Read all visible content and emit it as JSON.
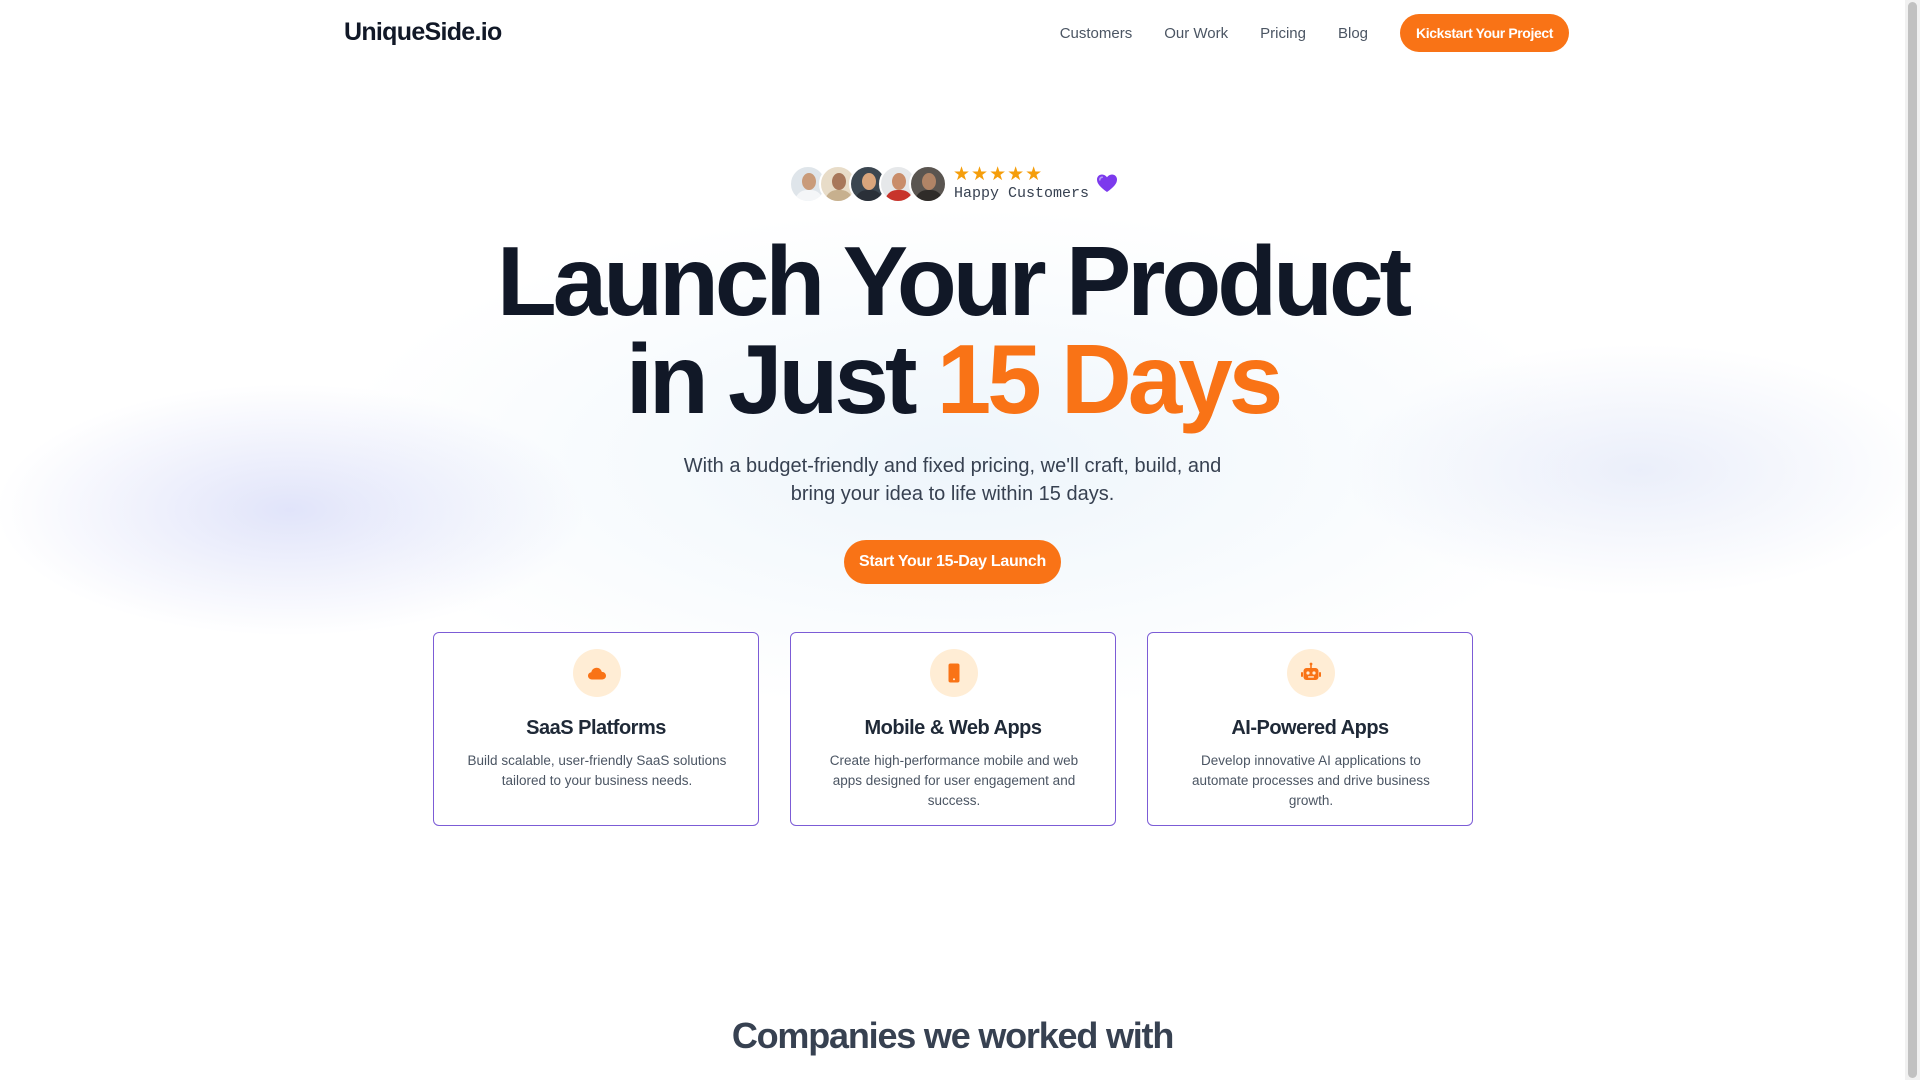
{
  "header": {
    "logo": "UniqueSide.io",
    "nav": [
      "Customers",
      "Our Work",
      "Pricing",
      "Blog"
    ],
    "cta_label": "Kickstart Your Project"
  },
  "social_proof": {
    "rating_stars": 5,
    "stars_text": "★★★★★",
    "label": "Happy Customers",
    "avatars": [
      "avatar-1",
      "avatar-2",
      "avatar-3",
      "avatar-4",
      "avatar-5"
    ],
    "heart_icon": "purple-heart-icon"
  },
  "hero": {
    "title_line1": "Launch Your Product",
    "title_line2_prefix": "in Just ",
    "title_line2_accent": "15 Days",
    "subtitle": "With a budget-friendly and fixed pricing, we'll craft, build, and bring your idea to life within 15 days.",
    "cta_label": "Start Your 15-Day Launch"
  },
  "cards": [
    {
      "icon": "cloud-icon",
      "title": "SaaS Platforms",
      "description": "Build scalable, user-friendly SaaS solutions tailored to your business needs."
    },
    {
      "icon": "mobile-phone-icon",
      "title": "Mobile & Web Apps",
      "description": "Create high-performance mobile and web apps designed for user engagement and success."
    },
    {
      "icon": "robot-icon",
      "title": "AI-Powered Apps",
      "description": "Develop innovative AI applications to automate processes and drive business growth."
    }
  ],
  "companies": {
    "title": "Companies we worked with"
  },
  "colors": {
    "accent": "#f97316",
    "accent_soft": "#ffedd5",
    "card_border": "#7c5cd6",
    "heart": "#7c3aed",
    "heading": "#111827"
  }
}
